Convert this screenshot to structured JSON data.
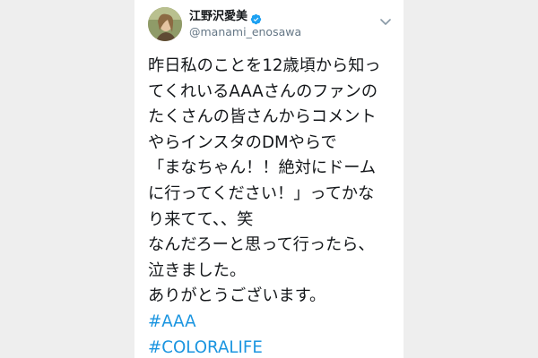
{
  "tweet": {
    "author": {
      "display_name": "江野沢愛美",
      "handle": "@manami_enosawa",
      "verified": true,
      "verified_icon": "verified-badge-icon",
      "avatar": "profile-photo"
    },
    "menu_icon": "chevron-down-icon",
    "lines": [
      "昨日私のことを12歳頃から知っ",
      "てくれいるAAAさんのファンの",
      "たくさんの皆さんからコメント",
      "やらインスタのDMやらで",
      "「まなちゃん！！絶対にドーム",
      "に行ってください！」ってかな",
      "り来てて、、笑",
      "なんだろーと思って行ったら、",
      "泣きました。",
      "ありがとうございます。"
    ],
    "hashtags": [
      "#AAA",
      "#COLORALIFE"
    ]
  },
  "colors": {
    "background": "#eeeeee",
    "card": "#ffffff",
    "text": "#14171a",
    "muted": "#657786",
    "link": "#1b95e0",
    "verified": "#1da1f2"
  }
}
